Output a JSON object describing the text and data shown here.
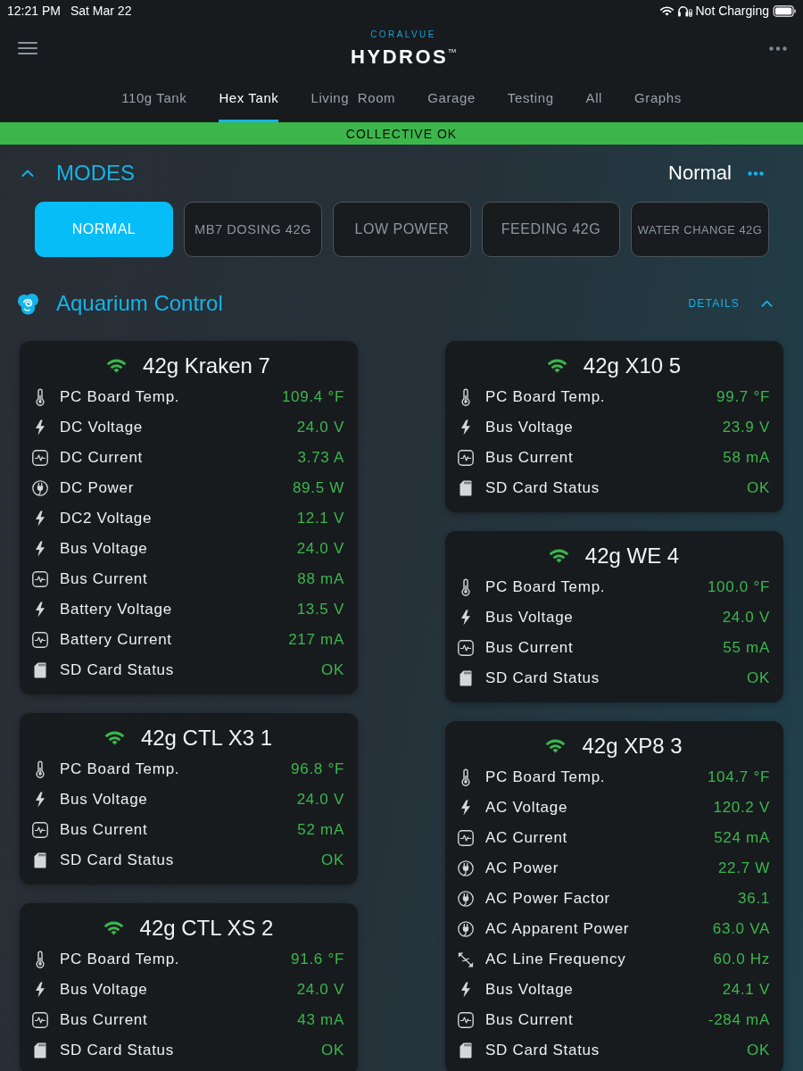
{
  "status_bar": {
    "time": "12:21 PM",
    "date": "Sat Mar 22",
    "charging_status": "Not Charging"
  },
  "header": {
    "brand_top": "CORALVUE",
    "brand": "HYDROS$^{TM}$"
  },
  "tabs": [
    {
      "label": "110g Tank",
      "selected": false
    },
    {
      "label": "Hex Tank",
      "selected": true
    },
    {
      "label": "Living  Room",
      "selected": false
    },
    {
      "label": "Garage",
      "selected": false
    },
    {
      "label": "Testing",
      "selected": false
    },
    {
      "label": "All",
      "selected": false
    },
    {
      "label": "Graphs",
      "selected": false
    }
  ],
  "banner": {
    "text": "COLLECTIVE OK",
    "healthy": true
  },
  "modes": {
    "title": "MODES",
    "expanded": true,
    "current": "Normal",
    "buttons": [
      {
        "label": "NORMAL",
        "selected": true
      },
      {
        "label": "MB7 DOSING 42G",
        "selected": false
      },
      {
        "label": "LOW POWER",
        "selected": false
      },
      {
        "label": "FEEDING 42G",
        "selected": false
      },
      {
        "label": "WATER CHANGE 42G",
        "selected": false
      }
    ]
  },
  "aquarium_control": {
    "title": "Aquarium Control",
    "details_label": "DETAILS",
    "expanded": true,
    "columns": [
      {
        "devices": [
          {
            "name": "42g Kraken 7",
            "connected": true,
            "readings": [
              {
                "kind": "temperature",
                "label": "PC Board Temp.",
                "value": "109.4 °F"
              },
              {
                "kind": "voltage",
                "label": "DC Voltage",
                "value": "24.0 V"
              },
              {
                "kind": "current",
                "label": "DC Current",
                "value": "3.73 A"
              },
              {
                "kind": "power",
                "label": "DC Power",
                "value": "89.5 W"
              },
              {
                "kind": "voltage",
                "label": "DC2 Voltage",
                "value": "12.1 V"
              },
              {
                "kind": "voltage",
                "label": "Bus Voltage",
                "value": "24.0 V"
              },
              {
                "kind": "current",
                "label": "Bus Current",
                "value": "88 mA"
              },
              {
                "kind": "voltage",
                "label": "Battery Voltage",
                "value": "13.5 V"
              },
              {
                "kind": "current",
                "label": "Battery Current",
                "value": "217 mA"
              },
              {
                "kind": "storage",
                "label": "SD Card Status",
                "value": "OK"
              }
            ]
          },
          {
            "name": "42g CTL X3 1",
            "connected": true,
            "readings": [
              {
                "kind": "temperature",
                "label": "PC Board Temp.",
                "value": "96.8 °F"
              },
              {
                "kind": "voltage",
                "label": "Bus Voltage",
                "value": "24.0 V"
              },
              {
                "kind": "current",
                "label": "Bus Current",
                "value": "52 mA"
              },
              {
                "kind": "storage",
                "label": "SD Card Status",
                "value": "OK"
              }
            ]
          },
          {
            "name": "42g CTL XS 2",
            "connected": true,
            "readings": [
              {
                "kind": "temperature",
                "label": "PC Board Temp.",
                "value": "91.6 °F"
              },
              {
                "kind": "voltage",
                "label": "Bus Voltage",
                "value": "24.0 V"
              },
              {
                "kind": "current",
                "label": "Bus Current",
                "value": "43 mA"
              },
              {
                "kind": "storage",
                "label": "SD Card Status",
                "value": "OK"
              }
            ]
          }
        ]
      },
      {
        "devices": [
          {
            "name": "42g X10 5",
            "connected": true,
            "readings": [
              {
                "kind": "temperature",
                "label": "PC Board Temp.",
                "value": "99.7 °F"
              },
              {
                "kind": "voltage",
                "label": "Bus Voltage",
                "value": "23.9 V"
              },
              {
                "kind": "current",
                "label": "Bus Current",
                "value": "58 mA"
              },
              {
                "kind": "storage",
                "label": "SD Card Status",
                "value": "OK"
              }
            ]
          },
          {
            "name": "42g WE 4",
            "connected": true,
            "readings": [
              {
                "kind": "temperature",
                "label": "PC Board Temp.",
                "value": "100.0 °F"
              },
              {
                "kind": "voltage",
                "label": "Bus Voltage",
                "value": "24.0 V"
              },
              {
                "kind": "current",
                "label": "Bus Current",
                "value": "55 mA"
              },
              {
                "kind": "storage",
                "label": "SD Card Status",
                "value": "OK"
              }
            ]
          },
          {
            "name": "42g XP8 3",
            "connected": true,
            "readings": [
              {
                "kind": "temperature",
                "label": "PC Board Temp.",
                "value": "104.7 °F"
              },
              {
                "kind": "voltage",
                "label": "AC Voltage",
                "value": "120.2 V"
              },
              {
                "kind": "current",
                "label": "AC Current",
                "value": "524 mA"
              },
              {
                "kind": "power",
                "label": "AC Power",
                "value": "22.7 W"
              },
              {
                "kind": "power",
                "label": "AC Power Factor",
                "value": "36.1"
              },
              {
                "kind": "power",
                "label": "AC Apparent Power",
                "value": "63.0 VA"
              },
              {
                "kind": "frequency",
                "label": "AC Line Frequency",
                "value": "60.0 Hz"
              },
              {
                "kind": "voltage",
                "label": "Bus Voltage",
                "value": "24.1 V"
              },
              {
                "kind": "current",
                "label": "Bus Current",
                "value": "-284 mA"
              },
              {
                "kind": "storage",
                "label": "SD Card Status",
                "value": "OK"
              }
            ]
          }
        ]
      }
    ]
  }
}
